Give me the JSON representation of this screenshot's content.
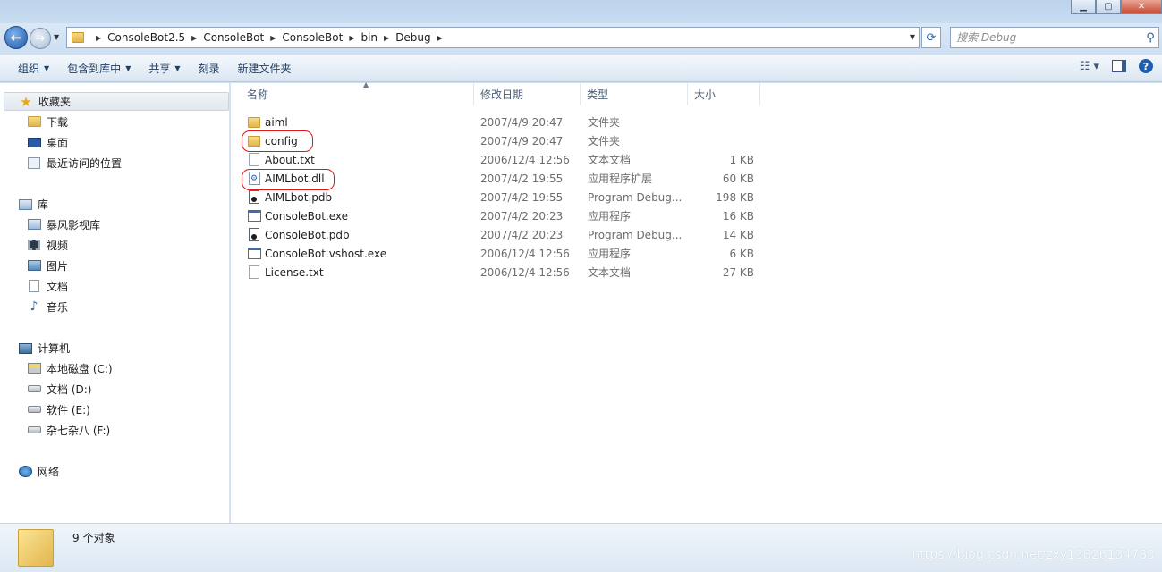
{
  "window": {
    "minimize_label": "▁",
    "maximize_label": "▢",
    "close_label": "✕"
  },
  "address": {
    "crumbs": [
      "ConsoleBot2.5",
      "ConsoleBot",
      "ConsoleBot",
      "bin",
      "Debug"
    ]
  },
  "search": {
    "placeholder": "搜索 Debug"
  },
  "toolbar": {
    "organize": "组织",
    "include_in_library": "包含到库中",
    "share": "共享",
    "burn": "刻录",
    "new_folder": "新建文件夹"
  },
  "sidebar": {
    "favorites": {
      "label": "收藏夹",
      "items": [
        "下载",
        "桌面",
        "最近访问的位置"
      ]
    },
    "libraries": {
      "label": "库",
      "items": [
        "暴风影视库",
        "视频",
        "图片",
        "文档",
        "音乐"
      ]
    },
    "computer": {
      "label": "计算机",
      "items": [
        "本地磁盘 (C:)",
        "文档 (D:)",
        "软件 (E:)",
        "杂七杂八 (F:)"
      ]
    },
    "network": {
      "label": "网络"
    }
  },
  "columns": {
    "name": "名称",
    "modified": "修改日期",
    "type": "类型",
    "size": "大小"
  },
  "files": [
    {
      "name": "aiml",
      "modified": "2007/4/9 20:47",
      "type": "文件夹",
      "size": "",
      "icon": "folder-icon"
    },
    {
      "name": "config",
      "modified": "2007/4/9 20:47",
      "type": "文件夹",
      "size": "",
      "icon": "folder-icon"
    },
    {
      "name": "About.txt",
      "modified": "2006/12/4 12:56",
      "type": "文本文档",
      "size": "1 KB",
      "icon": "text-file-icon"
    },
    {
      "name": "AIMLbot.dll",
      "modified": "2007/4/2 19:55",
      "type": "应用程序扩展",
      "size": "60 KB",
      "icon": "dll-file-icon"
    },
    {
      "name": "AIMLbot.pdb",
      "modified": "2007/4/2 19:55",
      "type": "Program Debug...",
      "size": "198 KB",
      "icon": "pdb-file-icon"
    },
    {
      "name": "ConsoleBot.exe",
      "modified": "2007/4/2 20:23",
      "type": "应用程序",
      "size": "16 KB",
      "icon": "exe-file-icon"
    },
    {
      "name": "ConsoleBot.pdb",
      "modified": "2007/4/2 20:23",
      "type": "Program Debug...",
      "size": "14 KB",
      "icon": "pdb-file-icon"
    },
    {
      "name": "ConsoleBot.vshost.exe",
      "modified": "2006/12/4 12:56",
      "type": "应用程序",
      "size": "6 KB",
      "icon": "exe-file-icon"
    },
    {
      "name": "License.txt",
      "modified": "2006/12/4 12:56",
      "type": "文本文档",
      "size": "27 KB",
      "icon": "text-file-icon"
    }
  ],
  "status": {
    "count": "9 个对象"
  },
  "watermark": "https://blog.csdn.net/zxy13826134783",
  "colors": {
    "annotation_red": "#e01515",
    "accent": "#1e5fb0"
  }
}
